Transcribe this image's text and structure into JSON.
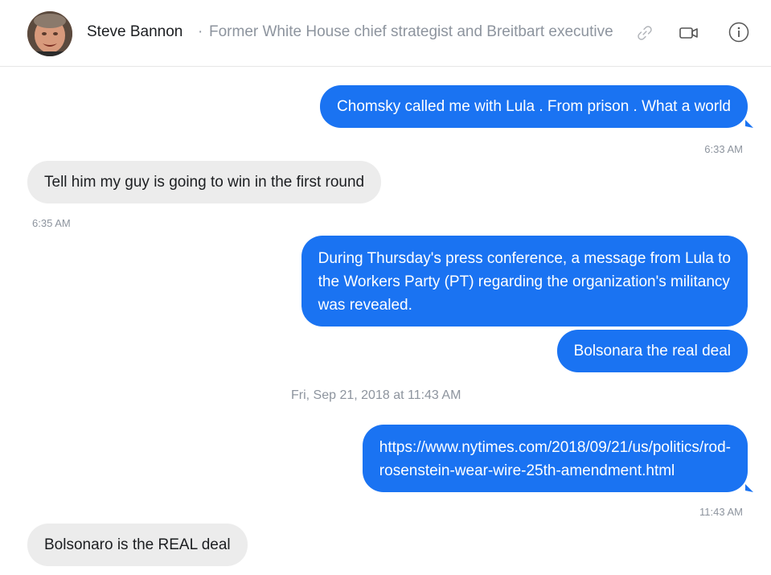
{
  "header": {
    "contact_name": "Steve Bannon",
    "separator": "·",
    "contact_description": "Former White House chief strategist and Breitbart executive",
    "icons": [
      "link-icon",
      "video-camera-icon",
      "info-icon"
    ]
  },
  "colors": {
    "outgoing_bubble": "#1a73f2",
    "incoming_bubble": "#ececec",
    "timestamp": "#8d949e"
  },
  "messages": [
    {
      "direction": "out",
      "lines": [
        "Chomsky called me with Lula . From prison . What a world"
      ]
    },
    {
      "direction": "out-timestamp",
      "text": "6:33 AM"
    },
    {
      "direction": "in",
      "lines": [
        "Tell him my guy is going to win in the first round"
      ]
    },
    {
      "direction": "in-timestamp",
      "text": "6:35 AM"
    },
    {
      "direction": "out",
      "lines": [
        "During Thursday's press conference, a message from Lula to",
        "the Workers Party (PT) regarding the organization's militancy",
        "was revealed."
      ]
    },
    {
      "direction": "out",
      "lines": [
        "Bolsonara the real deal"
      ]
    },
    {
      "direction": "date-separator",
      "text": "Fri, Sep 21, 2018 at 11:43 AM"
    },
    {
      "direction": "out",
      "lines": [
        "https://www.nytimes.com/2018/09/21/us/politics/rod-",
        "rosenstein-wear-wire-25th-amendment.html"
      ]
    },
    {
      "direction": "out-timestamp",
      "text": "11:43 AM"
    },
    {
      "direction": "in",
      "lines": [
        "Bolsonaro is the REAL deal"
      ]
    }
  ]
}
